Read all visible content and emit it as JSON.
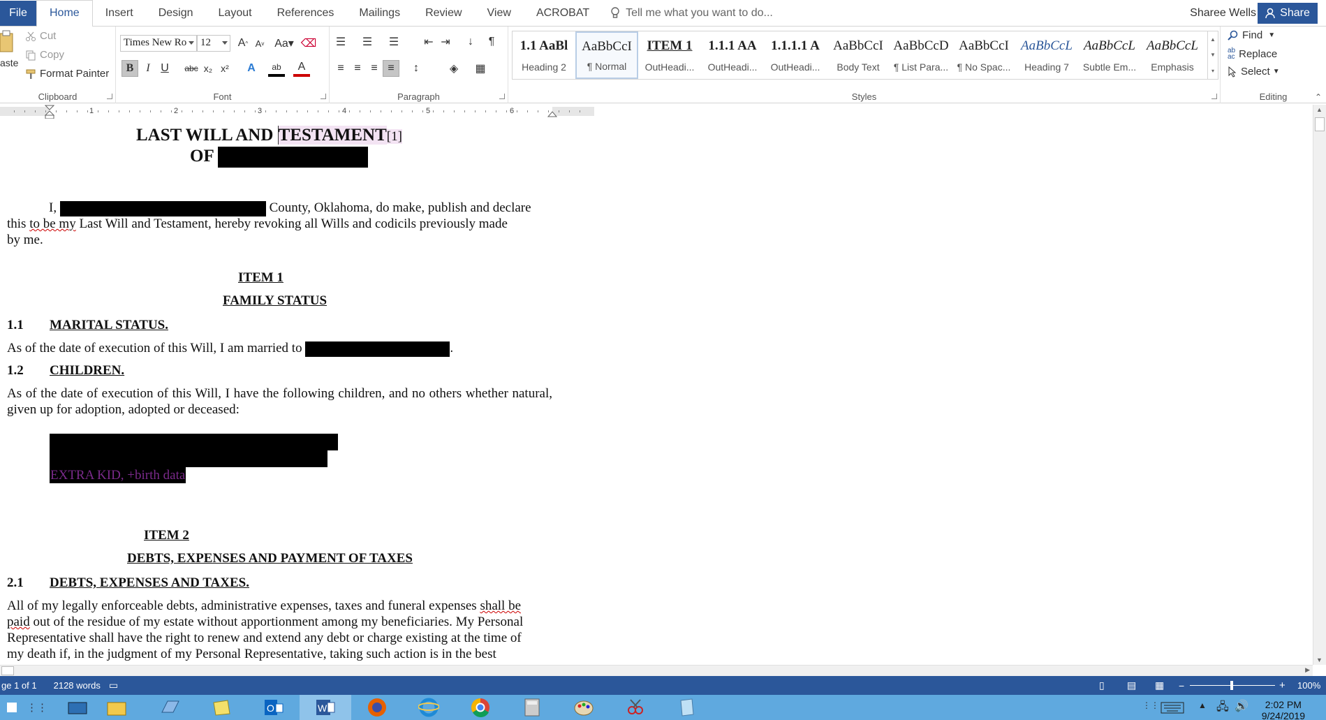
{
  "tabs": [
    "File",
    "Home",
    "Insert",
    "Design",
    "Layout",
    "References",
    "Mailings",
    "Review",
    "View",
    "ACROBAT"
  ],
  "active_tab": "Home",
  "tell_me": "Tell me what you want to do...",
  "user_name": "Sharee Wells",
  "share_label": "Share",
  "clipboard": {
    "paste": "aste",
    "cut": "Cut",
    "copy": "Copy",
    "format_painter": "Format Painter",
    "label": "Clipboard"
  },
  "font": {
    "name": "Times New Ro",
    "size": "12",
    "label": "Font"
  },
  "paragraph": {
    "label": "Paragraph"
  },
  "styles": {
    "label": "Styles",
    "items": [
      {
        "preview": "1.1  AaBl",
        "name": "Heading 2"
      },
      {
        "preview": "AaBbCcI",
        "name": "¶ Normal",
        "selected": true
      },
      {
        "preview": "ITEM 1",
        "name": "OutHeadi..."
      },
      {
        "preview": "1.1.1  AA",
        "name": "OutHeadi..."
      },
      {
        "preview": "1.1.1.1  A",
        "name": "OutHeadi..."
      },
      {
        "preview": "AaBbCcI",
        "name": "Body Text"
      },
      {
        "preview": "AaBbCcD",
        "name": "¶ List Para..."
      },
      {
        "preview": "AaBbCcI",
        "name": "¶ No Spac..."
      },
      {
        "preview": "AaBbCcL",
        "name": "Heading 7"
      },
      {
        "preview": "AaBbCcL",
        "name": "Subtle Em..."
      },
      {
        "preview": "AaBbCcL",
        "name": "Emphasis"
      }
    ]
  },
  "editing": {
    "find": "Find",
    "replace": "Replace",
    "select": "Select",
    "label": "Editing"
  },
  "ruler_numbers": [
    "1",
    "2",
    "3",
    "4",
    "5",
    "6"
  ],
  "document": {
    "title1": "LAST WILL AND",
    "title_highlight": "TESTAMENT",
    "title_footnote": "[1]",
    "title2": "OF",
    "intro_i": "I,",
    "intro_rest": "County, Oklahoma, do make, publish and declare",
    "intro_line2_a": "this",
    "intro_line2_squig": "to be my",
    "intro_line2_b": "Last Will and Testament, hereby revoking all Wills and codicils previously made",
    "intro_line3": "by me.",
    "item1": "ITEM 1",
    "family_status": "FAMILY STATUS",
    "s11_num": "1.1",
    "s11_title": "MARITAL STATUS.",
    "s11_text": "As of the date of execution of this Will, I am married to",
    "s11_end": ".",
    "s12_num": "1.2",
    "s12_title": "CHILDREN.",
    "s12_text": "As of the date of execution of this Will, I have the following children, and no others whether natural, given up for adoption, adopted or deceased:",
    "extra_kid": "EXTRA KID, +birth data",
    "item2": "ITEM 2",
    "debts_heading": "DEBTS, EXPENSES AND PAYMENT OF TAXES",
    "s21_num": "2.1",
    "s21_title": "DEBTS, EXPENSES AND TAXES.",
    "s21_line1_a": "All of my legally enforceable debts, administrative expenses, taxes and funeral expenses",
    "s21_line1_squig": "shall be",
    "s21_line2_squig": "paid",
    "s21_line2_b": "out of the residue of my estate without apportionment among my beneficiaries. My Personal",
    "s21_line3": "Representative shall have the right to renew and extend any debt or charge existing at the time of",
    "s21_line4": "my death if, in the judgment of my Personal Representative, taking such action is in the best"
  },
  "status": {
    "page": "ge 1 of 1",
    "words": "2128 words",
    "zoom": "100%"
  },
  "clock": {
    "time": "2:02 PM",
    "date": "9/24/2019"
  },
  "colors": {
    "accent": "#2b579a",
    "taskbar": "#5fa9df",
    "highlight": "#f3e3f3",
    "extra_kid": "#7a2a8a"
  }
}
